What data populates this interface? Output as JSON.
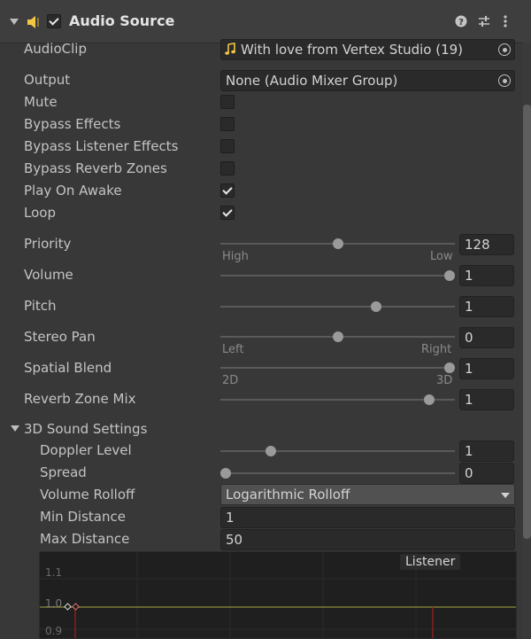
{
  "header": {
    "title": "Audio Source",
    "enabled": true
  },
  "fields": {
    "audioclip": {
      "label": "AudioClip",
      "value": "With love from Vertex Studio (19)"
    },
    "output": {
      "label": "Output",
      "value": "None (Audio Mixer Group)"
    }
  },
  "toggles": [
    {
      "label": "Mute",
      "checked": false
    },
    {
      "label": "Bypass Effects",
      "checked": false
    },
    {
      "label": "Bypass Listener Effects",
      "checked": false
    },
    {
      "label": "Bypass Reverb Zones",
      "checked": false
    },
    {
      "label": "Play On Awake",
      "checked": true
    },
    {
      "label": "Loop",
      "checked": true
    }
  ],
  "sliders": {
    "priority": {
      "label": "Priority",
      "value": "128",
      "fraction": 0.5,
      "min_label": "High",
      "max_label": "Low"
    },
    "volume": {
      "label": "Volume",
      "value": "1",
      "fraction": 1.0
    },
    "pitch": {
      "label": "Pitch",
      "value": "1",
      "fraction": 0.67
    },
    "stereo_pan": {
      "label": "Stereo Pan",
      "value": "0",
      "fraction": 0.5,
      "min_label": "Left",
      "max_label": "Right"
    },
    "spatial_blend": {
      "label": "Spatial Blend",
      "value": "1",
      "fraction": 1.0,
      "min_label": "2D",
      "max_label": "3D"
    },
    "reverb_zone_mix": {
      "label": "Reverb Zone Mix",
      "value": "1",
      "fraction": 0.91
    }
  },
  "sound3d": {
    "title": "3D Sound Settings",
    "doppler": {
      "label": "Doppler Level",
      "value": "1",
      "fraction": 0.2
    },
    "spread": {
      "label": "Spread",
      "value": "0",
      "fraction": 0.0
    },
    "rolloff": {
      "label": "Volume Rolloff",
      "value": "Logarithmic Rolloff"
    },
    "min_distance": {
      "label": "Min Distance",
      "value": "1"
    },
    "max_distance": {
      "label": "Max Distance",
      "value": "50"
    }
  },
  "graph": {
    "listener_label": "Listener",
    "y_ticks": [
      "1.1",
      "1.0",
      "0.9"
    ]
  },
  "colors": {
    "accent_yellow": "#f2c744",
    "curve_line": "#a0a03a",
    "listener_line": "#8a1f1f"
  },
  "icons": {
    "component": "audio-source-icon",
    "help": "help-icon",
    "presets": "presets-icon",
    "menu": "kebab-menu-icon",
    "clip": "music-note-icon",
    "picker": "object-picker-icon"
  }
}
